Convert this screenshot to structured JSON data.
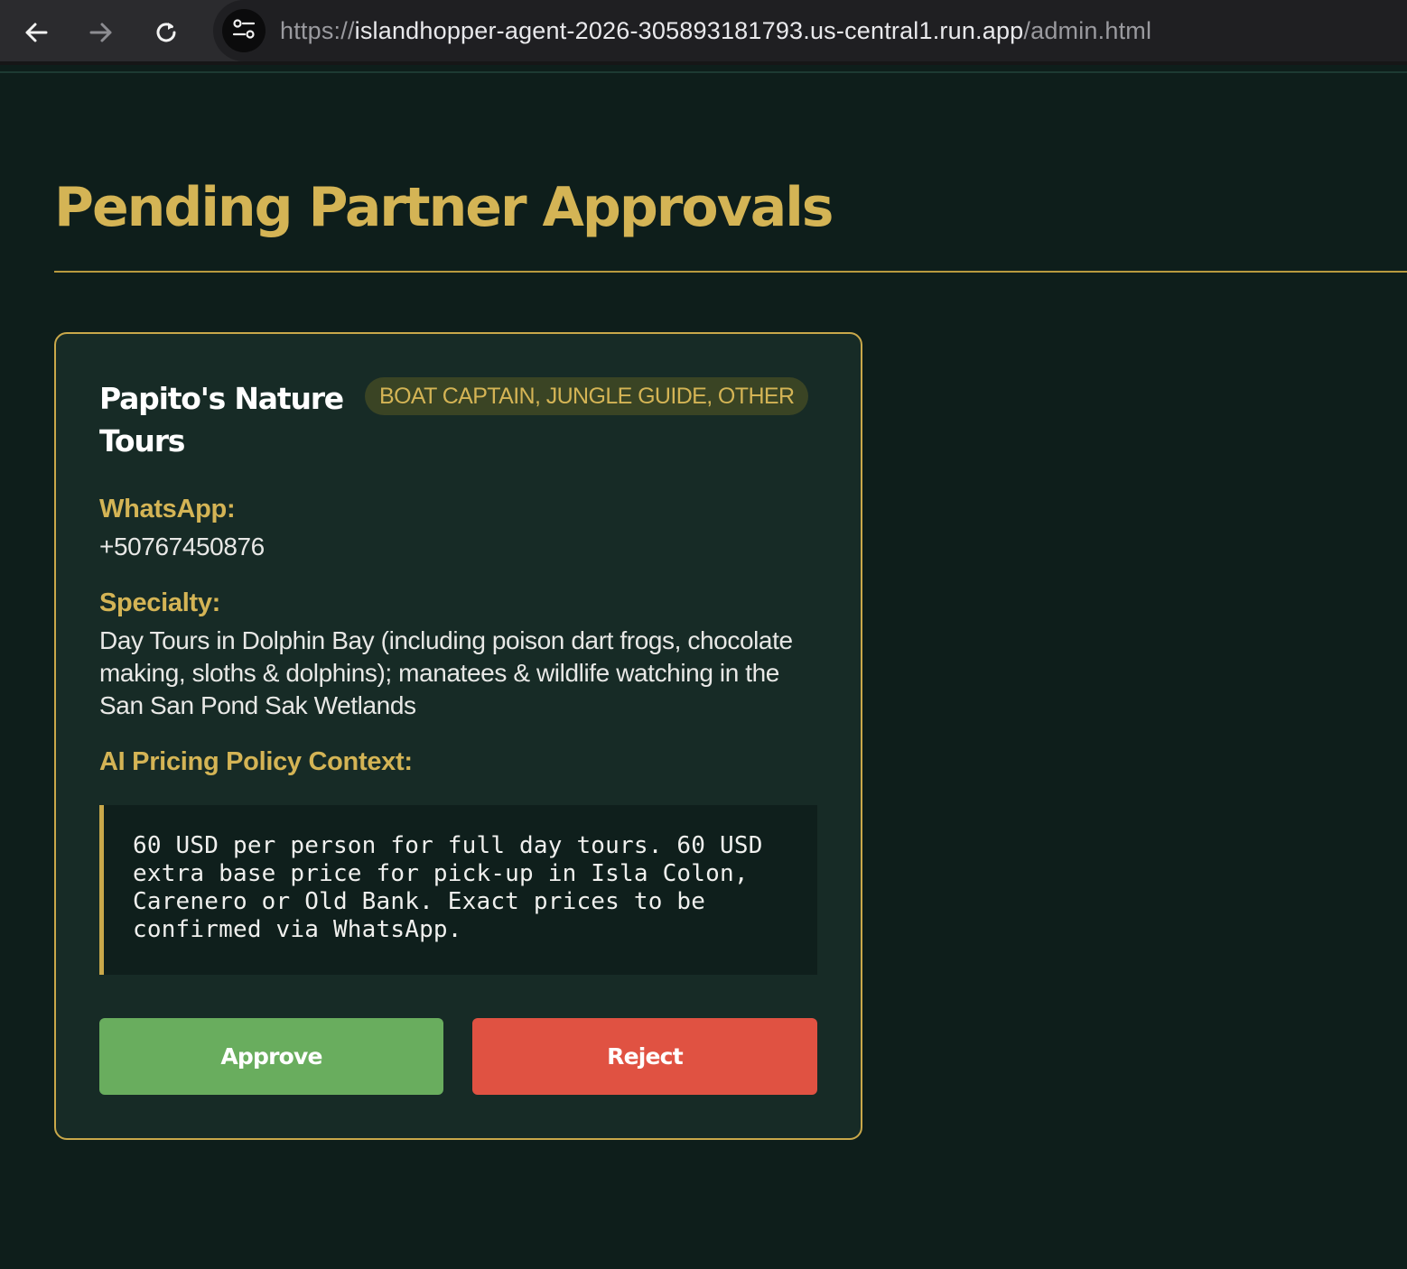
{
  "browser": {
    "url_scheme": "https://",
    "url_host": "islandhopper-agent-2026-305893181793.us-central1.run.app",
    "url_path": "/admin.html",
    "icons": {
      "back": "arrow-left-icon",
      "forward": "arrow-right-icon",
      "reload": "reload-icon",
      "site_info": "tune-icon"
    }
  },
  "page": {
    "title": "Pending Partner Approvals"
  },
  "partners": [
    {
      "name": "Papito's Nature Tours",
      "roles": "BOAT CAPTAIN, JUNGLE GUIDE, OTHER",
      "whatsapp_label": "WhatsApp:",
      "whatsapp": "+50767450876",
      "specialty_label": "Specialty:",
      "specialty": "Day Tours in Dolphin Bay (including poison dart frogs, chocolate making, sloths & dolphins); manatees & wildlife watching in the San San Pond Sak Wetlands",
      "policy_label": "AI Pricing Policy Context:",
      "policy": "60 USD per person for full day tours. 60 USD extra base price for pick-up in Isla Colon, Carenero or Old Bank. Exact prices to be confirmed via WhatsApp.",
      "approve_label": "Approve",
      "reject_label": "Reject"
    }
  ],
  "colors": {
    "background": "#0e1e1b",
    "card": "#172b26",
    "accent_gold": "#d4b455",
    "approve_green": "#69ad5e",
    "reject_red": "#e05242"
  }
}
